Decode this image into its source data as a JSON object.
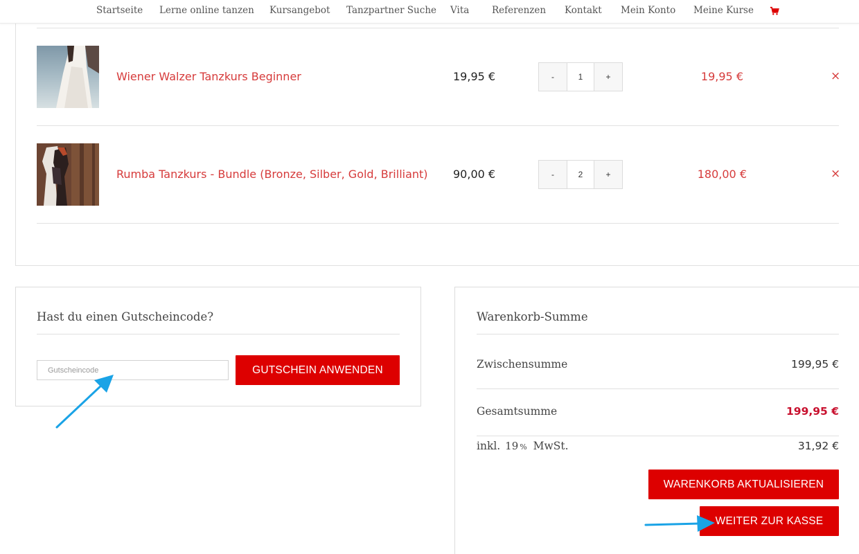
{
  "nav": {
    "items": [
      "Startseite",
      "Lerne online tanzen",
      "Kursangebot",
      "Tanzpartner Suche",
      "Vita",
      "Referenzen",
      "Kontakt",
      "Mein Konto",
      "Meine Kurse"
    ],
    "cart_icon": "shopping-cart-icon"
  },
  "cart": {
    "items": [
      {
        "name": "Wiener Walzer Tanzkurs Beginner",
        "price": "19,95 €",
        "quantity": "1",
        "subtotal": "19,95 €",
        "qty_minus": "-",
        "qty_plus": "+",
        "remove": "×"
      },
      {
        "name": "Rumba Tanzkurs - Bundle (Bronze, Silber, Gold, Brilliant)",
        "price": "90,00 €",
        "quantity": "2",
        "subtotal": "180,00 €",
        "qty_minus": "-",
        "qty_plus": "+",
        "remove": "×"
      }
    ]
  },
  "coupon": {
    "title": "Hast du einen Gutscheincode?",
    "placeholder": "Gutscheincode",
    "apply_button": "GUTSCHEIN ANWENDEN"
  },
  "totals": {
    "title": "Warenkorb-Summe",
    "subtotal_label": "Zwischensumme",
    "subtotal_value": "199,95 €",
    "total_label": "Gesamtsumme",
    "total_value": "199,95 €",
    "tax_prefix": "inkl.",
    "tax_rate": "19",
    "tax_percent_sign": "%",
    "tax_suffix": "MwSt.",
    "tax_value": "31,92 €",
    "update_button": "WARENKORB AKTUALISIEREN",
    "checkout_button": "WEITER ZUR KASSE"
  },
  "colors": {
    "accent_red": "#dd0000",
    "link_red": "#d63b3b",
    "annotation_blue": "#1aa3e6"
  }
}
